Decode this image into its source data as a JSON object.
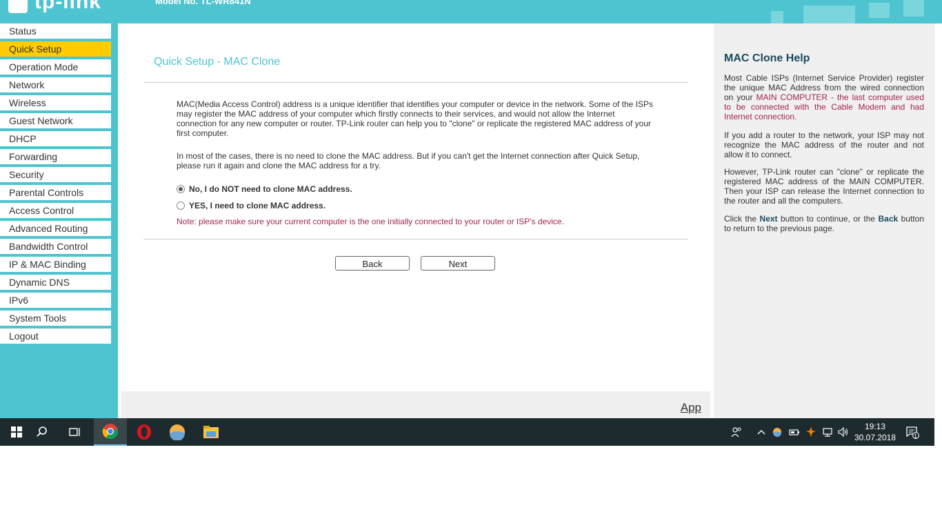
{
  "header": {
    "logo_text": "tp-link",
    "model_text": "Model No. TL-WR841N"
  },
  "sidebar": {
    "items": [
      {
        "label": "Status"
      },
      {
        "label": "Quick Setup"
      },
      {
        "label": "Operation Mode"
      },
      {
        "label": "Network"
      },
      {
        "label": "Wireless"
      },
      {
        "label": "Guest Network"
      },
      {
        "label": "DHCP"
      },
      {
        "label": "Forwarding"
      },
      {
        "label": "Security"
      },
      {
        "label": "Parental Controls"
      },
      {
        "label": "Access Control"
      },
      {
        "label": "Advanced Routing"
      },
      {
        "label": "Bandwidth Control"
      },
      {
        "label": "IP & MAC Binding"
      },
      {
        "label": "Dynamic DNS"
      },
      {
        "label": "IPv6"
      },
      {
        "label": "System Tools"
      },
      {
        "label": "Logout"
      }
    ],
    "active_item": "Quick Setup"
  },
  "main": {
    "title": "Quick Setup - MAC Clone",
    "paragraph1": "MAC(Media Access Control) address is a unique identifier that identifies your computer or device in the network. Some of the ISPs may register the MAC address of your computer which firstly connects to their services, and would not allow the Internet connection for any new computer or router. TP-Link router can help you to \"clone\" or replicate the registered MAC address of your first computer.",
    "paragraph2": "In most of the cases, there is no need to clone the MAC address. But if you can't get the Internet connection after Quick Setup, please run it again and clone the MAC address for a try.",
    "option_no": "No, I do NOT need to clone MAC address.",
    "option_yes": "YES, I need to clone MAC address.",
    "selected_option": "no",
    "note": "Note: please make sure your current computer is the one initially connected to your router or ISP's device.",
    "back_label": "Back",
    "next_label": "Next",
    "app_link": "App"
  },
  "help": {
    "title": "MAC Clone Help",
    "p1_a": "Most Cable ISPs (Internet Service Provider) register the unique MAC Address from the wired connection on your ",
    "p1_highlight": "MAIN COMPUTER - the last computer used to be connected with the Cable Modem and had Internet connection.",
    "p2": "If you add a router to the network, your ISP may not recognize the MAC address of the router and not allow it to connect.",
    "p3": "However, TP-Link router can \"clone\" or replicate the registered MAC address of the MAIN COMPUTER. Then your ISP can release the Internet connection to the router and all the computers.",
    "p4_a": "Click the ",
    "p4_next": "Next",
    "p4_b": " button to continue, or the ",
    "p4_back": "Back",
    "p4_c": " button to return to the previous page."
  },
  "taskbar": {
    "time": "19:13",
    "date": "30.07.2018",
    "notification_count": "1",
    "icons": [
      "windows-start-icon",
      "search-icon",
      "task-view-icon",
      "chrome-icon",
      "opera-icon",
      "app-icon",
      "file-explorer-icon"
    ]
  },
  "colors": {
    "brand": "#4dc4cf",
    "active_menu": "#ffcc00",
    "note": "#a3264b"
  }
}
